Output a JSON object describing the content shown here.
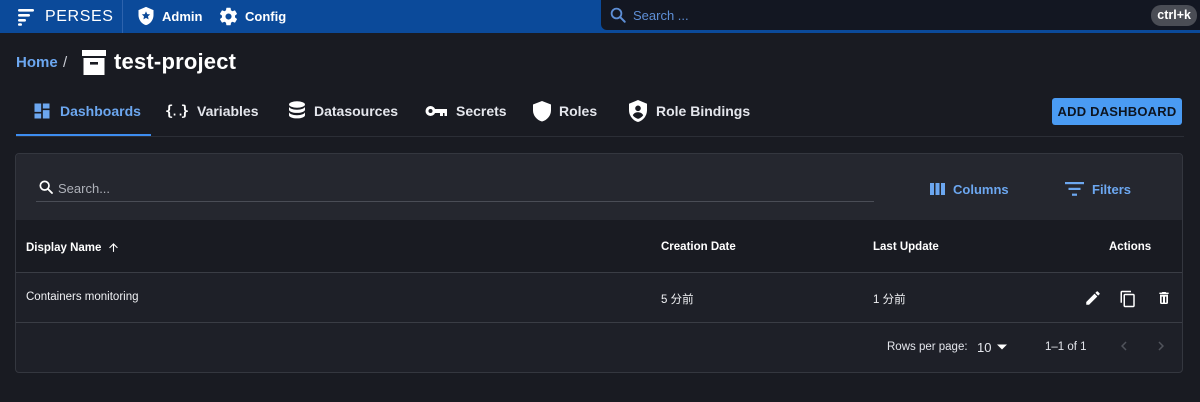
{
  "app": {
    "logo_text": "PERSES",
    "nav": [
      {
        "label": "Admin",
        "icon": "shield-star-icon"
      },
      {
        "label": "Config",
        "icon": "gear-icon"
      }
    ],
    "search_placeholder": "Search ...",
    "search_shortcut": "ctrl+k"
  },
  "breadcrumb": {
    "home": "Home",
    "separator": "/",
    "project_icon": "archive-box-icon",
    "project": "test-project"
  },
  "tabs": [
    {
      "label": "Dashboards",
      "icon": "dashboard-icon",
      "active": true
    },
    {
      "label": "Variables",
      "icon": "braces-icon",
      "active": false
    },
    {
      "label": "Datasources",
      "icon": "database-icon",
      "active": false
    },
    {
      "label": "Secrets",
      "icon": "key-icon",
      "active": false
    },
    {
      "label": "Roles",
      "icon": "shield-icon",
      "active": false
    },
    {
      "label": "Role Bindings",
      "icon": "shield-account-icon",
      "active": false
    }
  ],
  "add_button": "ADD DASHBOARD",
  "table": {
    "search_placeholder": "Search...",
    "columns_button": "Columns",
    "filters_button": "Filters",
    "headers": {
      "display_name": "Display Name",
      "creation_date": "Creation Date",
      "last_update": "Last Update",
      "actions": "Actions"
    },
    "sort": {
      "column": "display_name",
      "direction": "ascending"
    },
    "rows": [
      {
        "display_name": "Containers monitoring",
        "creation_date": "5 分前",
        "last_update": "1 分前",
        "actions": [
          "edit-icon",
          "duplicate-icon",
          "delete-icon"
        ]
      }
    ],
    "pagination": {
      "rows_per_page_label": "Rows per page:",
      "rows_per_page": "10",
      "range": "1–1 of 1"
    }
  },
  "colors": {
    "topbar": "#0b4a9a",
    "background": "#191b22",
    "accent": "#6ca7f0",
    "primary_button": "#4a9bf3"
  }
}
